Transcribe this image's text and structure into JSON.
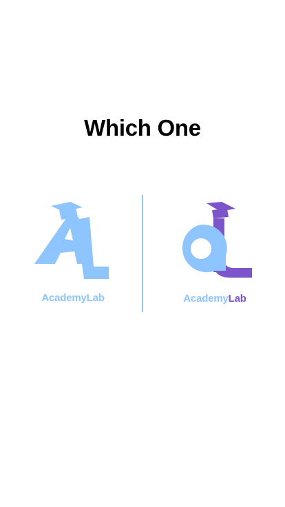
{
  "title": "Which One",
  "options": [
    {
      "name": "AcademyLab",
      "text_color": "#8ec5ff"
    },
    {
      "name_part1": "Academy",
      "name_part2": "Lab",
      "part1_color": "#8ec5ff",
      "part2_color": "#7b55c9"
    }
  ],
  "colors": {
    "background": "#ffffff",
    "light_blue": "#8ec5ff",
    "purple": "#7b55c9",
    "divider": "#8ec5ff"
  }
}
